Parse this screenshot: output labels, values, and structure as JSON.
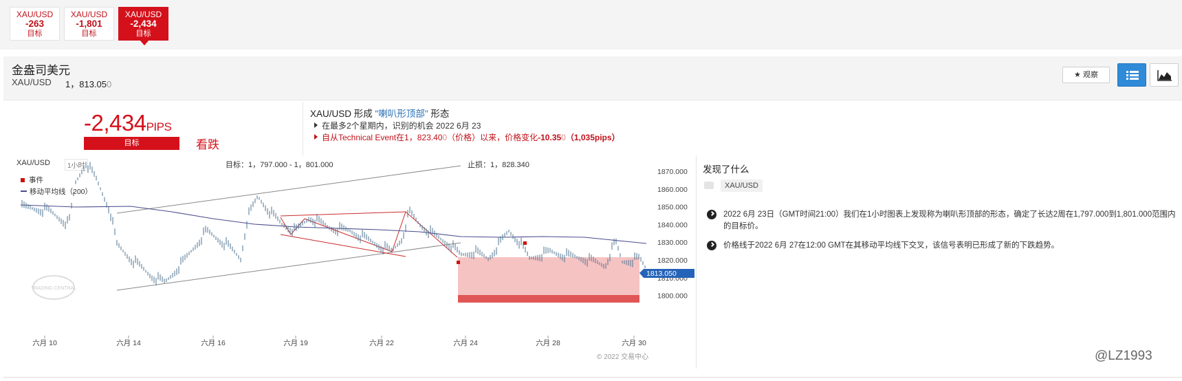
{
  "targets": [
    {
      "symbol": "XAU/USD",
      "value": "-263",
      "label": "目标"
    },
    {
      "symbol": "XAU/USD",
      "value": "-1,801",
      "label": "目标"
    },
    {
      "symbol": "XAU/USD",
      "value": "-2,434",
      "label": "目标"
    }
  ],
  "instrument": {
    "name": "金盎司美元",
    "symbol": "XAU/USD",
    "price_main": "1，813.05",
    "price_tail": "0"
  },
  "toolbar": {
    "watch_label": "观察"
  },
  "signal": {
    "pips_value": "-2,434",
    "pips_unit": "PIPS",
    "bar_label": "目标",
    "direction": "看跌"
  },
  "pattern": {
    "prefix": "XAU/USD 形成",
    "name": "\"喇叭形顶部\"",
    "suffix": "形态",
    "line1": "在最多2个星期内，识别的机会 2022 6月 23",
    "line2": "自从Technical Event在1，823.40",
    "line2_dim": "0",
    "line2_rest": "（价格）以来，价格变化",
    "line2_change": "-10.35",
    "line2_change_dim": "0",
    "line2_end": "（1,035pips）"
  },
  "chart": {
    "symbol": "XAU/USD",
    "interval": "1小时",
    "target_text": "目标：1，797.000 - 1，801.000",
    "stop_text": "止损：1，828.340",
    "legend_event": "事件",
    "legend_ma": "移动平均线（200）",
    "current_price_label": "1813.050",
    "copyright": "© 2022 交易中心",
    "logo_text": "TRADING CENTRAL",
    "accent": "#d4111b",
    "ma_color": "#4a4a8c"
  },
  "chart_data": {
    "type": "candlestick",
    "x_labels": [
      "六月 10",
      "六月 14",
      "六月 16",
      "六月 19",
      "六月 22",
      "六月 24",
      "六月 28",
      "六月 30"
    ],
    "y_ticks": [
      "1870.000",
      "1860.000",
      "1850.000",
      "1840.000",
      "1830.000",
      "1820.000",
      "1810.000",
      "1800.000"
    ],
    "ylim": [
      1800,
      1870
    ],
    "current_price": 1813.05,
    "target_zone": [
      1797.0,
      1801.0
    ],
    "stop_loss": 1828.34,
    "event_price": 1823.4
  },
  "findings": {
    "title": "发现了什么",
    "tag": "XAU/USD",
    "item1": "2022 6月 23日（GMT时间21:00）我们在1小时图表上发现称为喇叭形顶部的形态，确定了长达2周在1,797.000到1,801.000范围内的目标价。",
    "item2": "价格线于2022 6月 27在12:00 GMT在其移动平均线下交叉，该信号表明已形成了新的下跌趋势。"
  },
  "watermark": "@LZ1993"
}
